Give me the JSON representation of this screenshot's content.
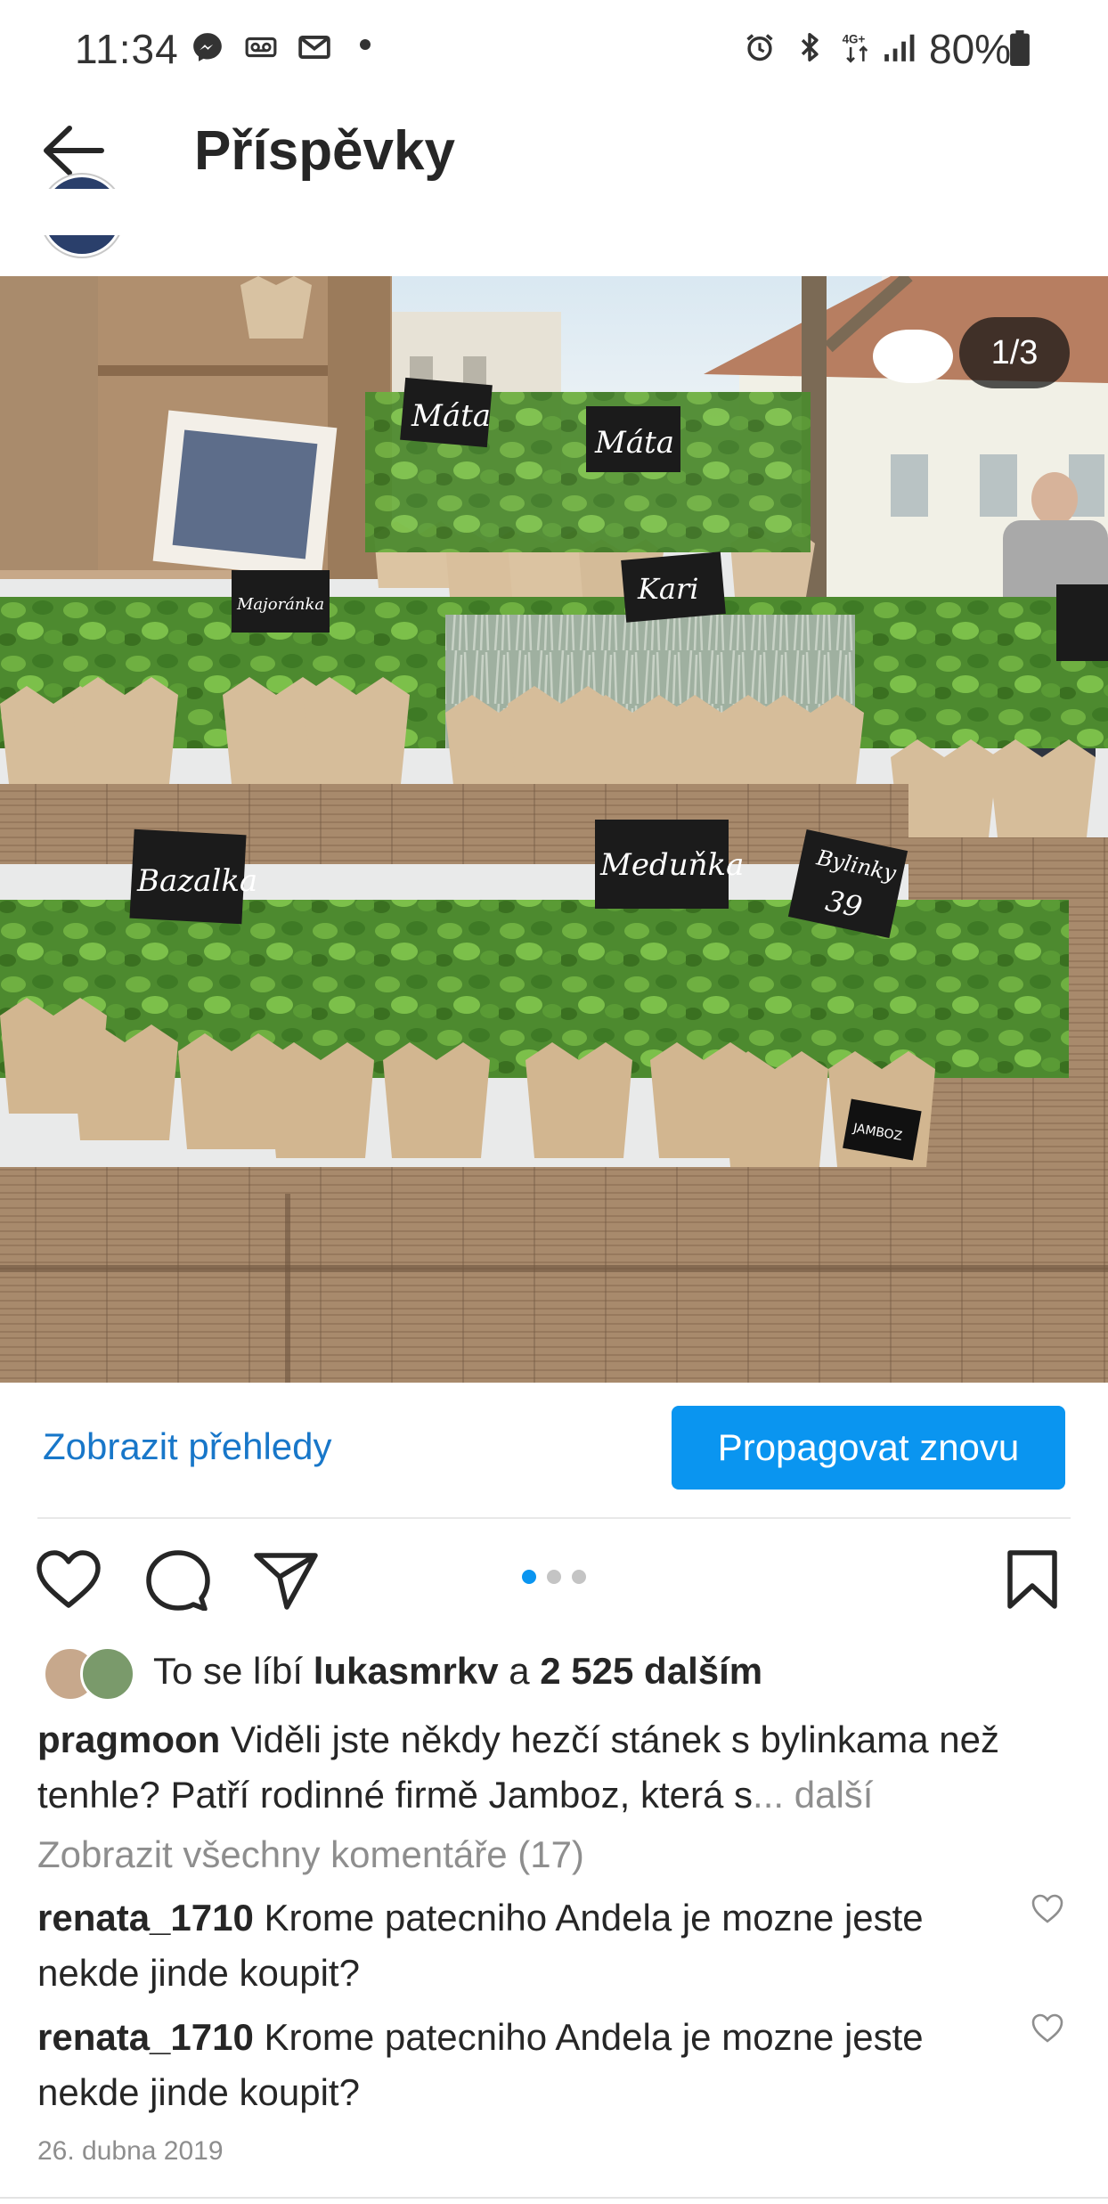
{
  "status_bar": {
    "time": "11:34",
    "battery": "80%",
    "icons": [
      "messenger-icon",
      "voicemail-icon",
      "mail-icon",
      "alarm-icon",
      "bluetooth-icon",
      "network-4g-icon",
      "signal-icon",
      "battery-icon"
    ]
  },
  "header": {
    "title": "Příspěvky",
    "back_icon": "arrow-left-icon"
  },
  "post": {
    "photo_counter": "1/3",
    "photo_signs": [
      "Máta",
      "Máta",
      "Majoránka",
      "Kari",
      "Bazalka",
      "Meduňka",
      "Bylinky",
      "39",
      "JAMBOZ"
    ],
    "insights_label": "Zobrazit přehledy",
    "promote_label": "Propagovat znovu",
    "carousel": {
      "count": 3,
      "active": 0
    },
    "likes": {
      "prefix": "To se líbí ",
      "user": "lukasmrkv",
      "mid": " a ",
      "count": "2 525 dalším"
    },
    "caption": {
      "author": "pragmoon",
      "text": " Viděli jste někdy hezčí stánek s bylinkama než tenhle? Patří rodinné firmě Jamboz, která s",
      "more": "... další"
    },
    "view_all_comments": "Zobrazit všechny komentáře (17)",
    "comments": [
      {
        "user": "renata_1710",
        "text": " Krome patecniho Andela je mozne jeste nekde jinde koupit?"
      },
      {
        "user": "renata_1710",
        "text": " Krome patecniho Andela je mozne jeste nekde jinde koupit?"
      }
    ],
    "date": "26. dubna 2019"
  },
  "colors": {
    "accent_link": "#1877c9",
    "promote_button": "#0a95f0",
    "muted_text": "#8e8e8e",
    "text": "#262626",
    "active_dot": "#0a95f0",
    "inactive_dot": "#c4c4c4"
  }
}
